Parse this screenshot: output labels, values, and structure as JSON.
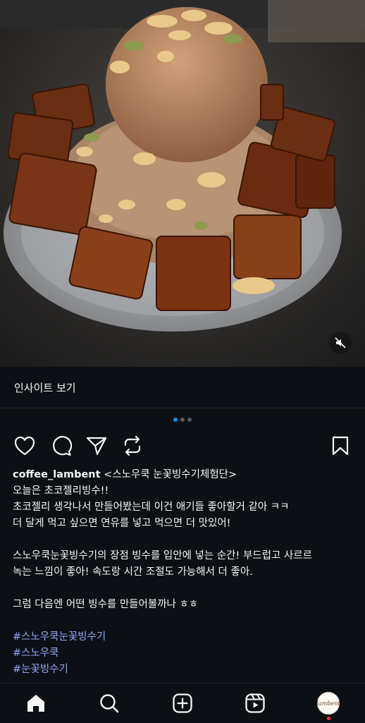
{
  "post": {
    "media": {
      "description_icon": "dessert-photo",
      "mute_icon": "speaker-muted-icon"
    },
    "insights_label": "인사이트 보기",
    "carousel": {
      "total": 3,
      "active_index": 0
    },
    "actions": [
      "like",
      "comment",
      "share",
      "remix",
      "save"
    ],
    "caption": {
      "username": "coffee_lambent",
      "first_line_rest": " <스노우쿡 눈꽃빙수기체험단>",
      "lines": [
        "오늘은 초코젤리빙수!!",
        "초코젤리 생각나서 만들어봤는데 이건 애기들 좋아할거 같아 ㅋㅋ",
        "더 달게 먹고 싶으면 연유를 넣고 먹으면 더 맛있어!",
        "",
        "스노우쿡눈꽃빙수기의 장점 빙수를 입안에 넣는 순간! 부드럽고 사르르",
        "녹는 느낌이 좋아! 속도랑 시간 조절도 가능해서 더 좋아.",
        "",
        "그럼 다음엔 어떤 빙수를 만들어볼까나 ㅎㅎ",
        ""
      ],
      "hashtags": [
        "#스노우쿡눈꽃빙수기",
        "#스노우쿡",
        "#눈꽃빙수기"
      ]
    }
  },
  "bottom_nav": {
    "items": [
      "home",
      "search",
      "create",
      "reels",
      "profile"
    ],
    "avatar_text": "lambent"
  },
  "colors": {
    "background": "#0c1014",
    "accent": "#0095f6",
    "hashtag": "#8ea6ff",
    "notification": "#ff3040"
  }
}
